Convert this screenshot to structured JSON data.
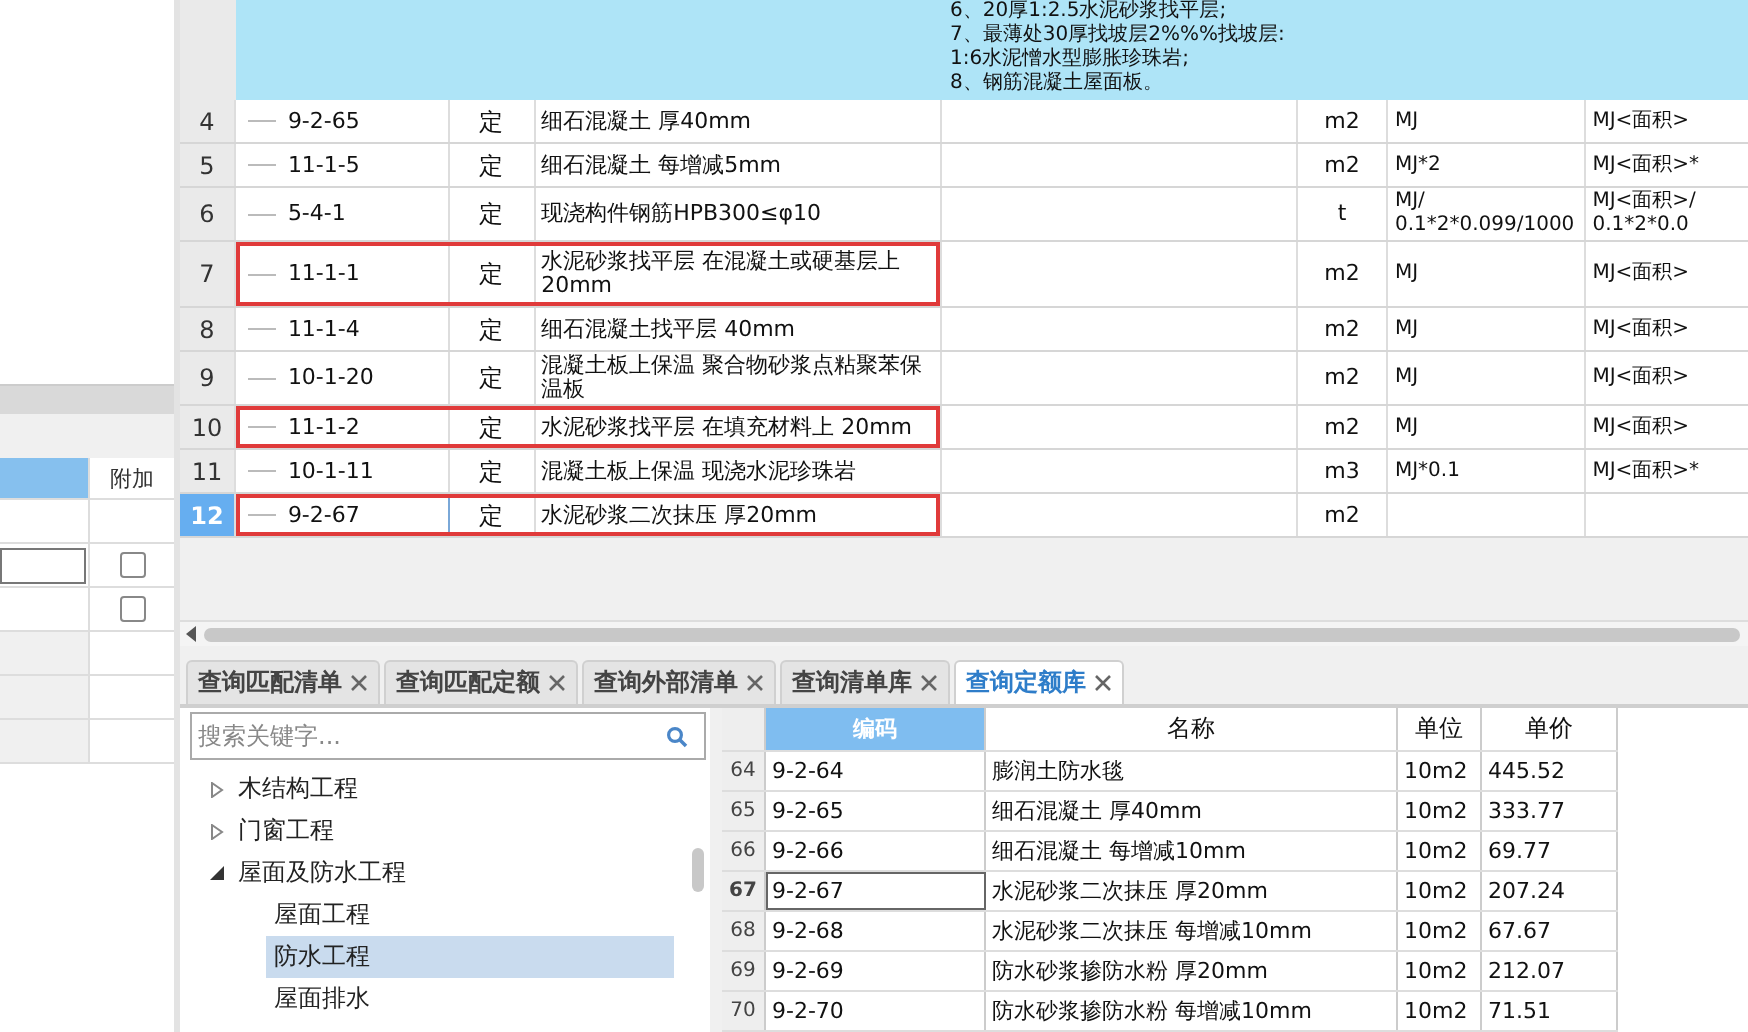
{
  "left_panel": {
    "table": {
      "columns": [
        "附加"
      ],
      "rows": [
        {
          "kind": "blank"
        },
        {
          "kind": "input",
          "checked": false
        },
        {
          "kind": "checkbox",
          "checked": false
        },
        {
          "kind": "shaded"
        },
        {
          "kind": "shaded"
        },
        {
          "kind": "shaded"
        }
      ]
    }
  },
  "main_grid": {
    "header_note": [
      "6、20厚1:2.5水泥砂浆找平层;",
      "7、最薄处30厚找坡层2%%%找坡层:",
      "1:6水泥憎水型膨胀珍珠岩;",
      "8、钢筋混凝土屋面板。"
    ],
    "rows": [
      {
        "num": "4",
        "code": "9-2-65",
        "type": "定",
        "name": "细石混凝土 厚40mm",
        "unit": "m2",
        "expr": "MJ",
        "expr_2": "MJ<面积>",
        "selected": false,
        "boxed": false
      },
      {
        "num": "5",
        "code": "11-1-5",
        "type": "定",
        "name": "细石混凝土 每增减5mm",
        "unit": "m2",
        "expr": "MJ*2",
        "expr_2": "MJ<面积>*",
        "selected": false,
        "boxed": false
      },
      {
        "num": "6",
        "code": "5-4-1",
        "type": "定",
        "name": "现浇构件钢筋HPB300≤φ10",
        "unit": "t",
        "expr": "MJ/ 0.1*2*0.099/1000",
        "expr_2": "MJ<面积>/ 0.1*2*0.0",
        "selected": false,
        "boxed": false
      },
      {
        "num": "7",
        "code": "11-1-1",
        "type": "定",
        "name": "水泥砂浆找平层 在混凝土或硬基层上 20mm",
        "unit": "m2",
        "expr": "MJ",
        "expr_2": "MJ<面积>",
        "selected": false,
        "boxed": true
      },
      {
        "num": "8",
        "code": "11-1-4",
        "type": "定",
        "name": "细石混凝土找平层 40mm",
        "unit": "m2",
        "expr": "MJ",
        "expr_2": "MJ<面积>",
        "selected": false,
        "boxed": false
      },
      {
        "num": "9",
        "code": "10-1-20",
        "type": "定",
        "name": "混凝土板上保温 聚合物砂浆点粘聚苯保温板",
        "unit": "m2",
        "expr": "MJ",
        "expr_2": "MJ<面积>",
        "selected": false,
        "boxed": false
      },
      {
        "num": "10",
        "code": "11-1-2",
        "type": "定",
        "name": "水泥砂浆找平层 在填充材料上 20mm",
        "unit": "m2",
        "expr": "MJ",
        "expr_2": "MJ<面积>",
        "selected": false,
        "boxed": true
      },
      {
        "num": "11",
        "code": "10-1-11",
        "type": "定",
        "name": "混凝土板上保温 现浇水泥珍珠岩",
        "unit": "m3",
        "expr": "MJ*0.1",
        "expr_2": "MJ<面积>*",
        "selected": false,
        "boxed": false
      },
      {
        "num": "12",
        "code": "9-2-67",
        "type": "定",
        "name": "水泥砂浆二次抹压 厚20mm",
        "unit": "m2",
        "expr": "",
        "expr_2": "",
        "selected": true,
        "boxed": true
      }
    ]
  },
  "bottom_tabs": [
    {
      "label": "查询匹配清单",
      "selected": false
    },
    {
      "label": "查询匹配定额",
      "selected": false
    },
    {
      "label": "查询外部清单",
      "selected": false
    },
    {
      "label": "查询清单库",
      "selected": false
    },
    {
      "label": "查询定额库",
      "selected": true
    }
  ],
  "search": {
    "placeholder": "搜索关键字..."
  },
  "tree": [
    {
      "label": "木结构工程",
      "expanded": false,
      "selected": false
    },
    {
      "label": "门窗工程",
      "expanded": false,
      "selected": false
    },
    {
      "label": "屋面及防水工程",
      "expanded": true,
      "selected": false,
      "children": [
        {
          "label": "屋面工程",
          "selected": false
        },
        {
          "label": "防水工程",
          "selected": true
        },
        {
          "label": "屋面排水",
          "selected": false
        }
      ]
    }
  ],
  "quota_table": {
    "columns": [
      "编码",
      "名称",
      "单位",
      "单价"
    ],
    "rows": [
      {
        "num": "64",
        "code": "9-2-64",
        "name": "膨润土防水毯",
        "unit": "10m2",
        "price": "445.52",
        "selected": false
      },
      {
        "num": "65",
        "code": "9-2-65",
        "name": "细石混凝土 厚40mm",
        "unit": "10m2",
        "price": "333.77",
        "selected": false
      },
      {
        "num": "66",
        "code": "9-2-66",
        "name": "细石混凝土 每增减10mm",
        "unit": "10m2",
        "price": "69.77",
        "selected": false
      },
      {
        "num": "67",
        "code": "9-2-67",
        "name": "水泥砂浆二次抹压 厚20mm",
        "unit": "10m2",
        "price": "207.24",
        "selected": true
      },
      {
        "num": "68",
        "code": "9-2-68",
        "name": "水泥砂浆二次抹压 每增减10mm",
        "unit": "10m2",
        "price": "67.67",
        "selected": false
      },
      {
        "num": "69",
        "code": "9-2-69",
        "name": "防水砂浆掺防水粉 厚20mm",
        "unit": "10m2",
        "price": "212.07",
        "selected": false
      },
      {
        "num": "70",
        "code": "9-2-70",
        "name": "防水砂浆掺防水粉 每增减10mm",
        "unit": "10m2",
        "price": "71.51",
        "selected": false
      }
    ]
  }
}
